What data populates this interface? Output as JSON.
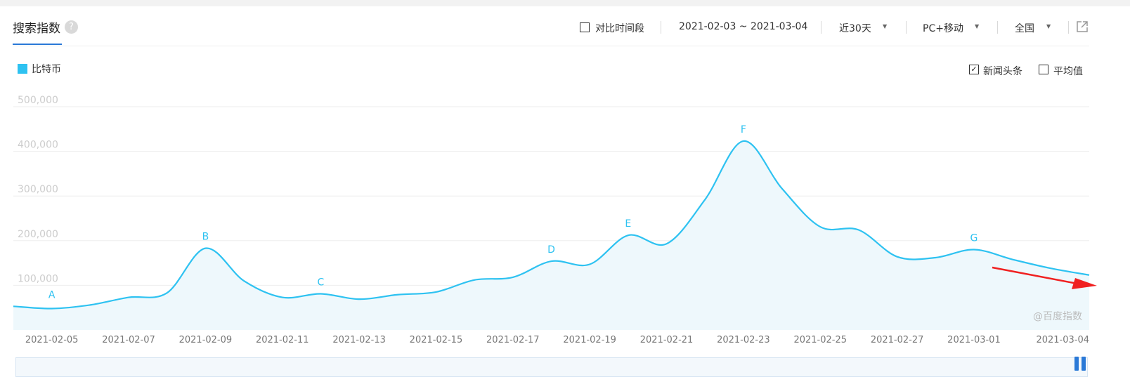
{
  "header": {
    "title": "搜索指数",
    "help_icon": "?",
    "compare_label": "对比时间段",
    "date_range": "2021-02-03 ~ 2021-03-04",
    "period": "近30天",
    "device": "PC+移动",
    "region": "全国",
    "share_icon": "external-link-icon"
  },
  "legend": {
    "series_name": "比特币",
    "color": "#2ec2f1"
  },
  "options": {
    "news_label": "新闻头条",
    "news_checked": true,
    "avg_label": "平均值",
    "avg_checked": false
  },
  "watermark": "@百度指数",
  "chart_data": {
    "type": "area",
    "x": [
      "2021-02-04",
      "2021-02-05",
      "2021-02-06",
      "2021-02-07",
      "2021-02-08",
      "2021-02-09",
      "2021-02-10",
      "2021-02-11",
      "2021-02-12",
      "2021-02-13",
      "2021-02-14",
      "2021-02-15",
      "2021-02-16",
      "2021-02-17",
      "2021-02-18",
      "2021-02-19",
      "2021-02-20",
      "2021-02-21",
      "2021-02-22",
      "2021-02-23",
      "2021-02-24",
      "2021-02-25",
      "2021-02-26",
      "2021-02-27",
      "2021-02-28",
      "2021-03-01",
      "2021-03-02",
      "2021-03-03",
      "2021-03-04"
    ],
    "series": [
      {
        "name": "比特币",
        "values": [
          53000,
          48000,
          56000,
          73000,
          83000,
          183000,
          110000,
          73000,
          81000,
          69000,
          79000,
          85000,
          112000,
          118000,
          154000,
          147000,
          212000,
          193000,
          292000,
          423000,
          317000,
          231000,
          224000,
          164000,
          162000,
          180000,
          158000,
          138000,
          123000
        ]
      }
    ],
    "xticks": [
      "2021-02-05",
      "2021-02-07",
      "2021-02-09",
      "2021-02-11",
      "2021-02-13",
      "2021-02-15",
      "2021-02-17",
      "2021-02-19",
      "2021-02-21",
      "2021-02-23",
      "2021-02-25",
      "2021-02-27",
      "2021-03-01",
      "2021-03-04"
    ],
    "yticks": [
      "100,000",
      "200,000",
      "300,000",
      "400,000",
      "500,000"
    ],
    "ytick_values": [
      100000,
      200000,
      300000,
      400000,
      500000
    ],
    "ylim": [
      0,
      500000
    ],
    "grid": true,
    "legend_position": "top-left",
    "annotations": [
      {
        "label": "A",
        "x": "2021-02-05",
        "y": 53000
      },
      {
        "label": "B",
        "x": "2021-02-09",
        "y": 183000
      },
      {
        "label": "C",
        "x": "2021-02-12",
        "y": 81000
      },
      {
        "label": "D",
        "x": "2021-02-18",
        "y": 154000
      },
      {
        "label": "E",
        "x": "2021-02-20",
        "y": 212000
      },
      {
        "label": "F",
        "x": "2021-02-23",
        "y": 423000
      },
      {
        "label": "G",
        "x": "2021-03-01",
        "y": 180000
      }
    ],
    "colors": {
      "line": "#2ec2f1",
      "fill": "#eef8fc",
      "grid": "#eeeeee",
      "arrow": "#f02020",
      "axis_text": "#777777",
      "ytick_text": "#cccccc"
    }
  }
}
